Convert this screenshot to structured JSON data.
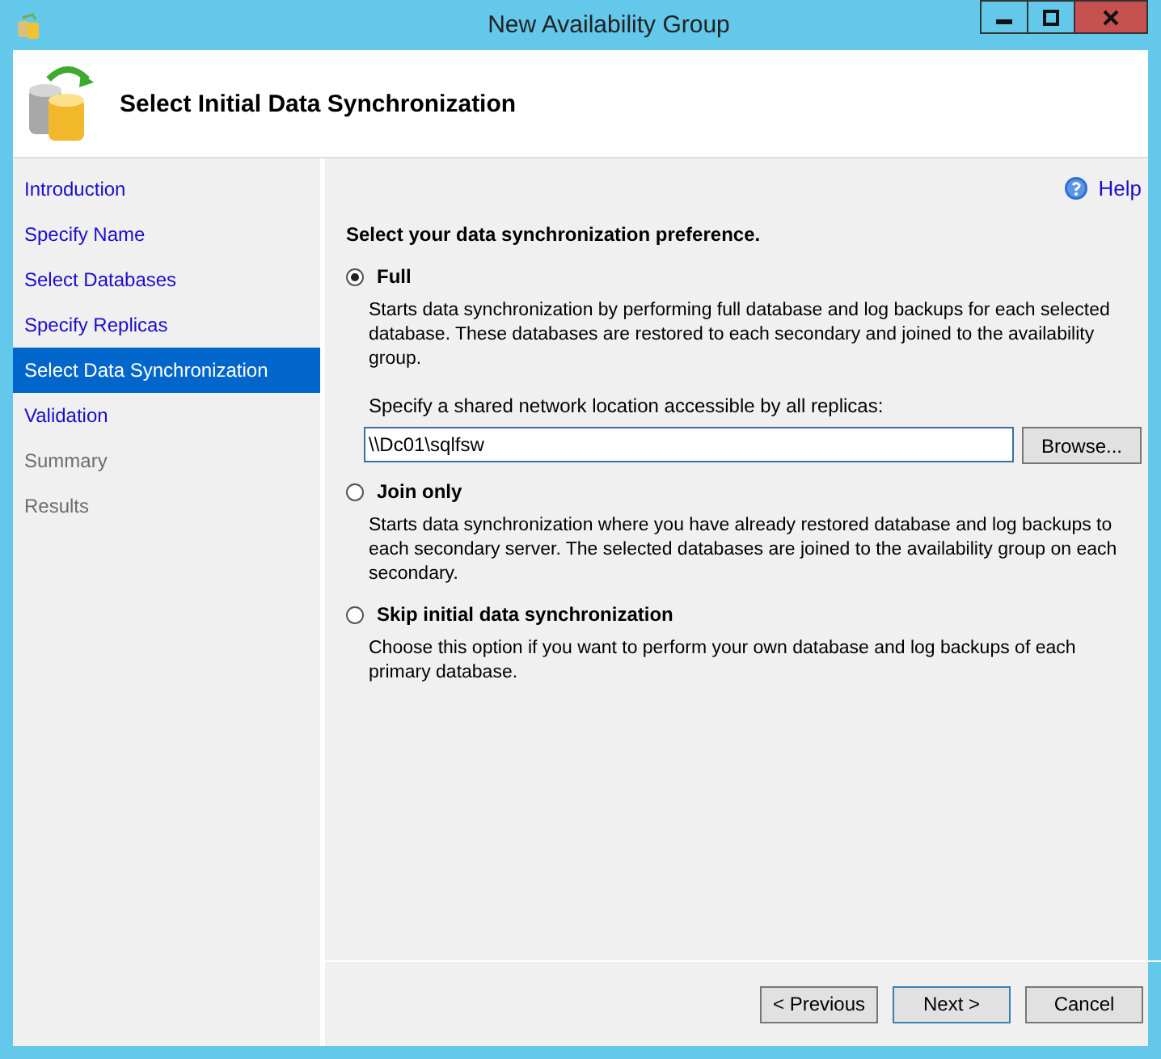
{
  "window": {
    "title": "New Availability Group"
  },
  "header": {
    "title": "Select Initial Data Synchronization"
  },
  "sidebar": {
    "items": [
      {
        "label": "Introduction",
        "selected": false,
        "disabled": false
      },
      {
        "label": "Specify Name",
        "selected": false,
        "disabled": false
      },
      {
        "label": "Select Databases",
        "selected": false,
        "disabled": false
      },
      {
        "label": "Specify Replicas",
        "selected": false,
        "disabled": false
      },
      {
        "label": "Select Data Synchronization",
        "selected": true,
        "disabled": false
      },
      {
        "label": "Validation",
        "selected": false,
        "disabled": false
      },
      {
        "label": "Summary",
        "selected": false,
        "disabled": true
      },
      {
        "label": "Results",
        "selected": false,
        "disabled": true
      }
    ]
  },
  "help": {
    "label": "Help"
  },
  "prompt": "Select your data synchronization preference.",
  "options": [
    {
      "label": "Full",
      "selected": true,
      "description": "Starts data synchronization by performing full database and log backups for each selected database. These databases are restored to each secondary and joined to the availability group.",
      "location": {
        "label": "Specify a shared network location accessible by all replicas:",
        "value": "\\\\Dc01\\sqlfsw",
        "browse": "Browse..."
      }
    },
    {
      "label": "Join only",
      "selected": false,
      "description": "Starts data synchronization where you have already restored database and log backups to each secondary server. The selected databases are joined to the availability group on each secondary."
    },
    {
      "label": "Skip initial data synchronization",
      "selected": false,
      "description": "Choose this option if you want to perform your own database and log backups of each primary database."
    }
  ],
  "buttons": [
    {
      "label": "< Previous",
      "selected": false
    },
    {
      "label": "Next >",
      "selected": true
    },
    {
      "label": "Cancel",
      "selected": false
    }
  ]
}
